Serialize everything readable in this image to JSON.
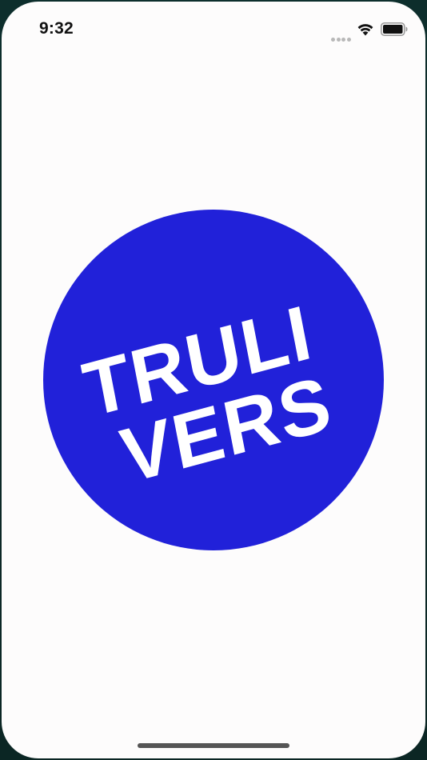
{
  "status_bar": {
    "time": "9:32",
    "wifi_icon": "wifi-icon",
    "battery_icon": "battery-icon",
    "signal_icon": "signal-dots-icon"
  },
  "logo": {
    "line1": "TRULI",
    "line2": "VERS",
    "circle_color": "#2121d9",
    "text_color": "#ffffff"
  },
  "colors": {
    "background": "#fdfcfc",
    "frame": "#0d2e2c"
  }
}
